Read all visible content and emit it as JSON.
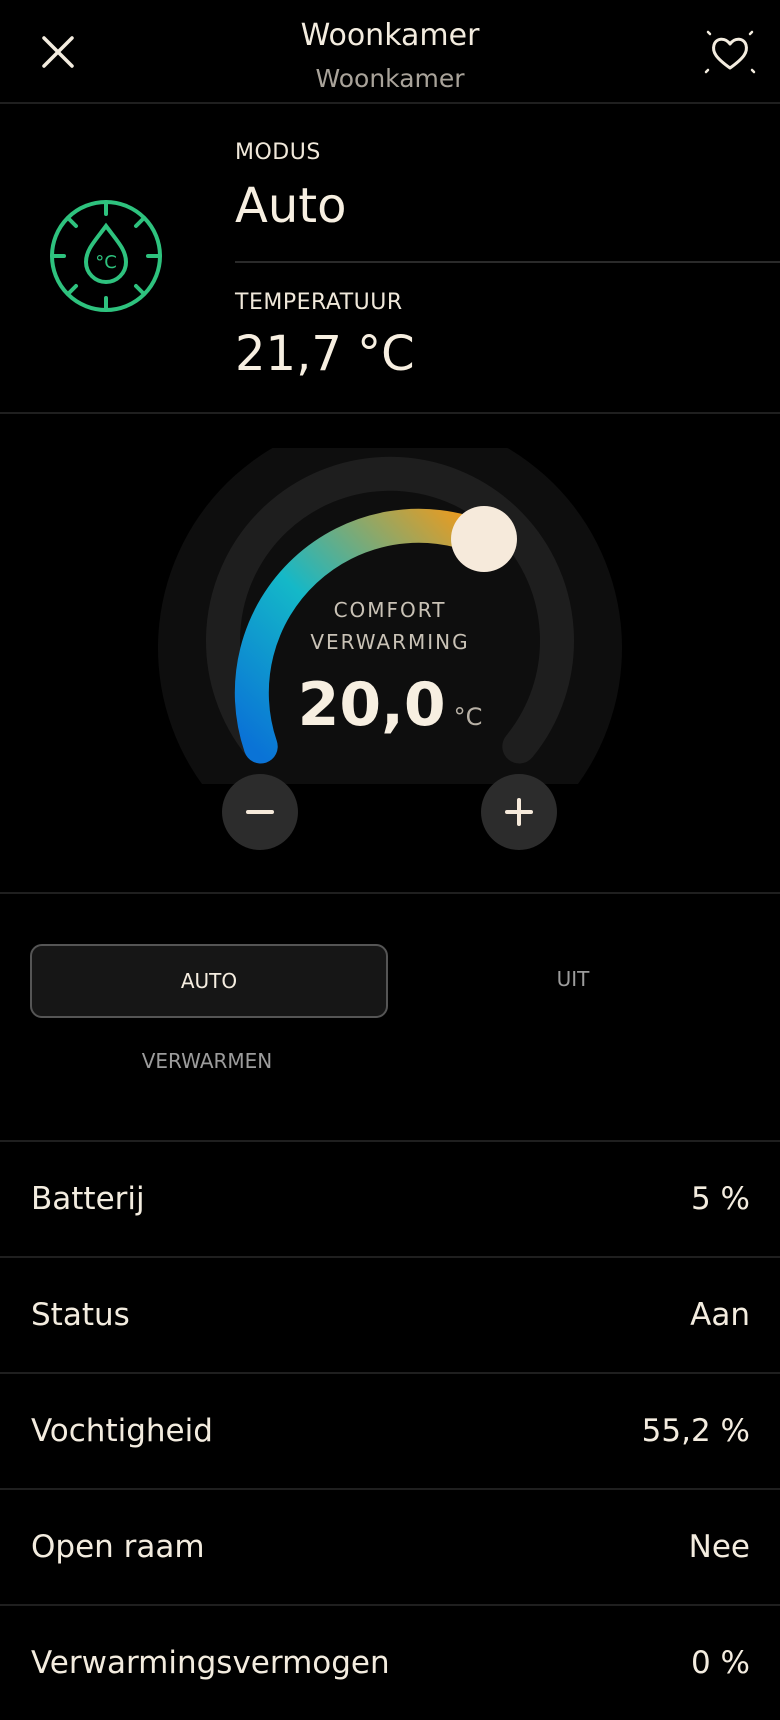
{
  "header": {
    "title": "Woonkamer",
    "subtitle": "Woonkamer",
    "close_icon": "close-icon",
    "favorite_icon": "heart-sparkle-icon"
  },
  "status": {
    "mode_label": "MODUS",
    "mode_value": "Auto",
    "temp_label": "TEMPERATUUR",
    "temp_value": "21,7 °C",
    "mode_icon": "thermostat-droplet-icon",
    "icon_color": "#2ec27e",
    "icon_text": "°C"
  },
  "dial": {
    "mode_line1": "COMFORT",
    "mode_line2": "VERWARMING",
    "setpoint": "20,0",
    "unit": "°C",
    "minus_icon": "minus-icon",
    "plus_icon": "plus-icon",
    "gradient_start": "#0a73d6",
    "gradient_mid": "#14b8c8",
    "gradient_end": "#f29a1a",
    "knob_color": "#f6eadb"
  },
  "modes": {
    "auto": "AUTO",
    "off": "UIT",
    "heat": "VERWARMEN",
    "selected": "AUTO"
  },
  "rows": [
    {
      "label": "Batterij",
      "value": "5  %"
    },
    {
      "label": "Status",
      "value": "Aan"
    },
    {
      "label": "Vochtigheid",
      "value": "55,2  %"
    },
    {
      "label": "Open raam",
      "value": "Nee"
    },
    {
      "label": "Verwarmingsvermogen",
      "value": "0  %"
    }
  ]
}
